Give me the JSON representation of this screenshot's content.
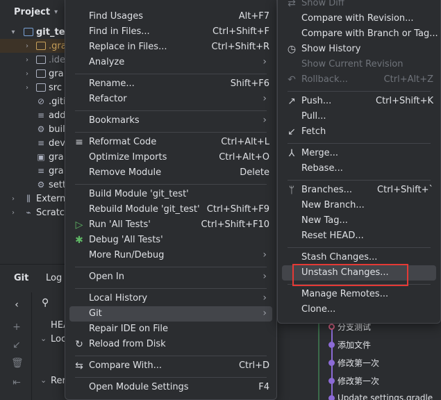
{
  "project": {
    "header_label": "Project",
    "tree": [
      {
        "label": "git_tes",
        "icon": "module-folder-icon",
        "expanded": true
      },
      {
        "label": ".gra",
        "icon": "folder-icon"
      },
      {
        "label": ".ide",
        "icon": "folder-icon"
      },
      {
        "label": "gra",
        "icon": "folder-icon"
      },
      {
        "label": "src",
        "icon": "folder-icon"
      },
      {
        "label": ".giti",
        "icon": "ignore-file-icon"
      },
      {
        "label": "add",
        "icon": "text-file-icon"
      },
      {
        "label": "buil",
        "icon": "gradle-file-icon"
      },
      {
        "label": "dev",
        "icon": "text-file-icon"
      },
      {
        "label": "gra",
        "icon": "image-file-icon"
      },
      {
        "label": "gra",
        "icon": "text-file-icon"
      },
      {
        "label": "sett",
        "icon": "gradle-file-icon"
      },
      {
        "label": "Externa",
        "icon": "library-icon"
      },
      {
        "label": "Scratch",
        "icon": "scratches-icon"
      }
    ]
  },
  "git_panel": {
    "tab_git": "Git",
    "tab_log": "Log",
    "tree_head": "HEA",
    "tree_local": "Loc",
    "tree_remote": "Rer"
  },
  "commits": [
    {
      "message": "分支测试"
    },
    {
      "message": "添加文件"
    },
    {
      "message": "修改第一次"
    },
    {
      "message": "修改第一次"
    },
    {
      "message": "Update settings.gradle"
    }
  ],
  "context_menu": {
    "items": [
      {
        "label": "Find Usages",
        "shortcut": "Alt+F7"
      },
      {
        "label": "Find in Files...",
        "shortcut": "Ctrl+Shift+F"
      },
      {
        "label": "Replace in Files...",
        "shortcut": "Ctrl+Shift+R"
      },
      {
        "label": "Analyze",
        "shortcut": ""
      },
      {
        "label": "Rename...",
        "shortcut": "Shift+F6"
      },
      {
        "label": "Refactor",
        "shortcut": ""
      },
      {
        "label": "Bookmarks",
        "shortcut": ""
      },
      {
        "label": "Reformat Code",
        "shortcut": "Ctrl+Alt+L"
      },
      {
        "label": "Optimize Imports",
        "shortcut": "Ctrl+Alt+O"
      },
      {
        "label": "Remove Module",
        "shortcut": "Delete"
      },
      {
        "label": "Build Module 'git_test'",
        "shortcut": ""
      },
      {
        "label": "Rebuild Module 'git_test'",
        "shortcut": "Ctrl+Shift+F9"
      },
      {
        "label": "Run 'All Tests'",
        "shortcut": "Ctrl+Shift+F10"
      },
      {
        "label": "Debug 'All Tests'",
        "shortcut": ""
      },
      {
        "label": "More Run/Debug",
        "shortcut": ""
      },
      {
        "label": "Open In",
        "shortcut": ""
      },
      {
        "label": "Local History",
        "shortcut": ""
      },
      {
        "label": "Git",
        "shortcut": ""
      },
      {
        "label": "Repair IDE on File",
        "shortcut": ""
      },
      {
        "label": "Reload from Disk",
        "shortcut": ""
      },
      {
        "label": "Compare With...",
        "shortcut": "Ctrl+D"
      },
      {
        "label": "Open Module Settings",
        "shortcut": "F4"
      }
    ]
  },
  "git_submenu": {
    "items": [
      {
        "label": "Show Diff",
        "shortcut": ""
      },
      {
        "label": "Compare with Revision...",
        "shortcut": ""
      },
      {
        "label": "Compare with Branch or Tag...",
        "shortcut": ""
      },
      {
        "label": "Show History",
        "shortcut": ""
      },
      {
        "label": "Show Current Revision",
        "shortcut": ""
      },
      {
        "label": "Rollback...",
        "shortcut": "Ctrl+Alt+Z"
      },
      {
        "label": "Push...",
        "shortcut": "Ctrl+Shift+K"
      },
      {
        "label": "Pull...",
        "shortcut": ""
      },
      {
        "label": "Fetch",
        "shortcut": ""
      },
      {
        "label": "Merge...",
        "shortcut": ""
      },
      {
        "label": "Rebase...",
        "shortcut": ""
      },
      {
        "label": "Branches...",
        "shortcut": "Ctrl+Shift+`"
      },
      {
        "label": "New Branch...",
        "shortcut": ""
      },
      {
        "label": "New Tag...",
        "shortcut": ""
      },
      {
        "label": "Reset HEAD...",
        "shortcut": ""
      },
      {
        "label": "Stash Changes...",
        "shortcut": ""
      },
      {
        "label": "Unstash Changes...",
        "shortcut": ""
      },
      {
        "label": "Manage Remotes...",
        "shortcut": ""
      },
      {
        "label": "Clone...",
        "shortcut": ""
      }
    ]
  },
  "colors": {
    "annotation_highlight": "#e53935",
    "hover": "#43454a",
    "menu_bg": "#2b2d30"
  }
}
